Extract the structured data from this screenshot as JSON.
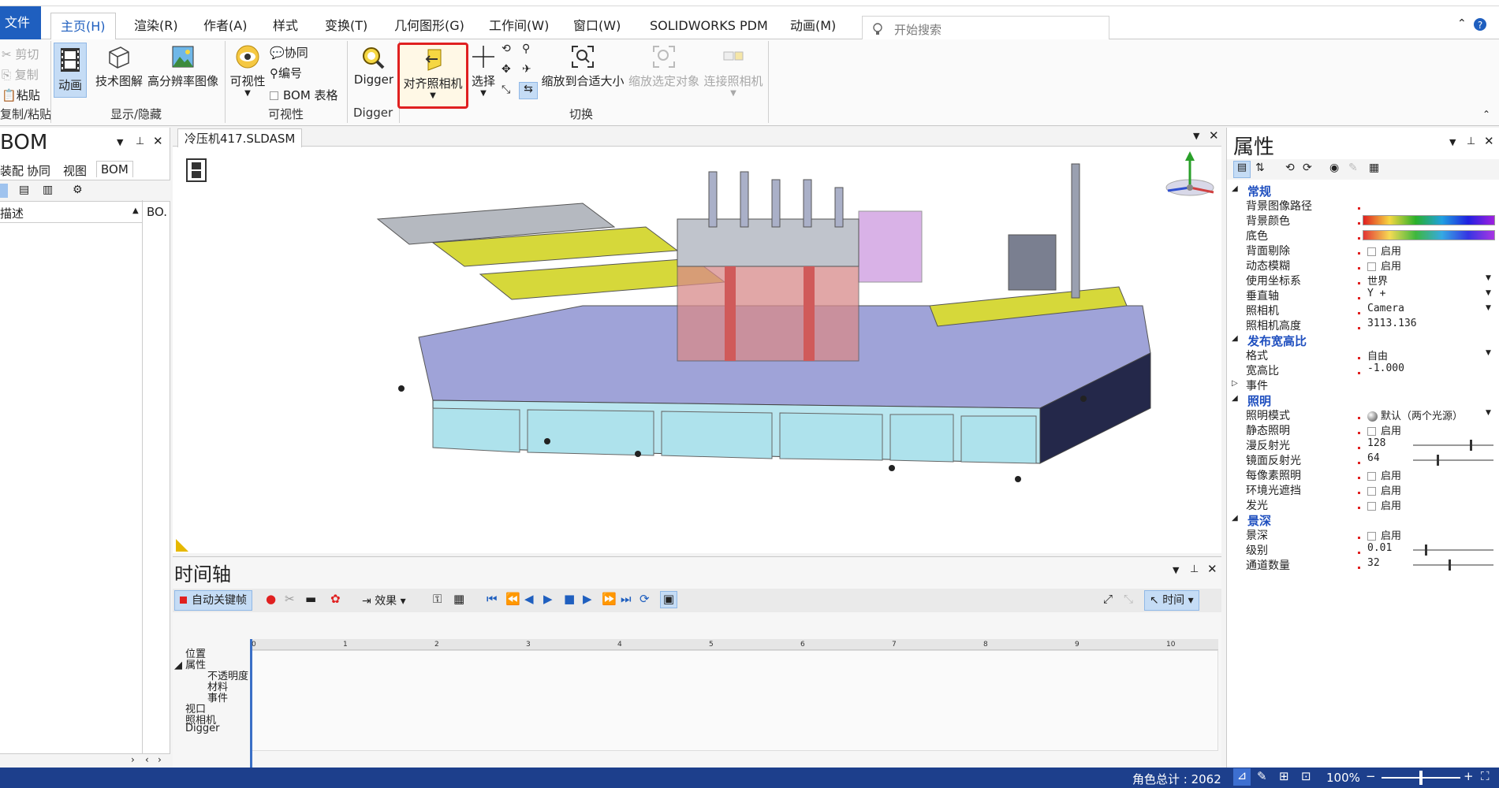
{
  "menu": {
    "file": "文件",
    "tabs": [
      "主页(H)",
      "渲染(R)",
      "作者(A)",
      "样式",
      "变换(T)",
      "几何图形(G)",
      "工作间(W)",
      "窗口(W)",
      "SOLIDWORKS PDM",
      "动画(M)"
    ],
    "search_placeholder": "开始搜索"
  },
  "ribbon": {
    "clipboard": {
      "cut": "剪切",
      "copy": "复制",
      "paste": "粘贴",
      "group": "复制/粘贴"
    },
    "show_hide": {
      "animation": "动画",
      "tech_illustration": "技术图解",
      "hires_image": "高分辨率图像",
      "group": "显示/隐藏"
    },
    "visibility": {
      "visibility": "可视性",
      "collab": "协同",
      "numbering": "编号",
      "bom_table": "BOM 表格",
      "group": "可视性"
    },
    "digger": {
      "label": "Digger",
      "group": "Digger"
    },
    "switch": {
      "align_camera": "对齐照相机",
      "select": "选择",
      "zoom_fit": "缩放到合适大小",
      "zoom_selected": "缩放选定对象",
      "connect_camera": "连接照相机",
      "group": "切换"
    }
  },
  "bom": {
    "title": "BOM",
    "tabs": [
      "装配",
      "协同",
      "视图",
      "BOM"
    ],
    "col_desc": "描述",
    "col_bom": "BO."
  },
  "document": {
    "tab": "冷压机417.SLDASM"
  },
  "properties": {
    "title": "属性",
    "rows": [
      {
        "type": "cat",
        "label": "常规"
      },
      {
        "type": "row",
        "label": "背景图像路径",
        "value": ""
      },
      {
        "type": "row",
        "label": "背景颜色",
        "value": "",
        "kind": "color1"
      },
      {
        "type": "row",
        "label": "底色",
        "value": "",
        "kind": "color2"
      },
      {
        "type": "row",
        "label": "背面剔除",
        "value": "启用",
        "kind": "check"
      },
      {
        "type": "row",
        "label": "动态模糊",
        "value": "启用",
        "kind": "check"
      },
      {
        "type": "row",
        "label": "使用坐标系",
        "value": "世界",
        "kind": "select"
      },
      {
        "type": "row",
        "label": "垂直轴",
        "value": "Y +",
        "kind": "select"
      },
      {
        "type": "row",
        "label": "照相机",
        "value": "Camera",
        "kind": "select"
      },
      {
        "type": "row",
        "label": "照相机高度",
        "value": "3113.136"
      },
      {
        "type": "cat",
        "label": "发布宽高比"
      },
      {
        "type": "row",
        "label": "格式",
        "value": "自由",
        "kind": "select"
      },
      {
        "type": "row",
        "label": "宽高比",
        "value": "-1.000"
      },
      {
        "type": "sub",
        "label": "事件"
      },
      {
        "type": "cat",
        "label": "照明"
      },
      {
        "type": "row",
        "label": "照明模式",
        "value": "默认（两个光源）",
        "kind": "lightsel"
      },
      {
        "type": "row",
        "label": "静态照明",
        "value": "启用",
        "kind": "check"
      },
      {
        "type": "row",
        "label": "漫反射光",
        "value": "128",
        "kind": "slider",
        "level": 0.72
      },
      {
        "type": "row",
        "label": "镜面反射光",
        "value": "64",
        "kind": "slider",
        "level": 0.3
      },
      {
        "type": "row",
        "label": "每像素照明",
        "value": "启用",
        "kind": "check"
      },
      {
        "type": "row",
        "label": "环境光遮挡",
        "value": "启用",
        "kind": "check"
      },
      {
        "type": "row",
        "label": "发光",
        "value": "启用",
        "kind": "check"
      },
      {
        "type": "cat",
        "label": "景深"
      },
      {
        "type": "row",
        "label": "景深",
        "value": "启用",
        "kind": "check"
      },
      {
        "type": "row",
        "label": "级别",
        "value": "0.01",
        "kind": "slider",
        "level": 0.15
      },
      {
        "type": "row",
        "label": "通道数量",
        "value": "32",
        "kind": "slider",
        "level": 0.45
      }
    ]
  },
  "timeline": {
    "title": "时间轴",
    "auto_key": "自动关键帧",
    "effects": "效果",
    "time_mode": "时间",
    "tracks": [
      "位置",
      "属性",
      "不透明度",
      "材料",
      "事件",
      "视口",
      "照相机",
      "Digger"
    ],
    "ruler": [
      "0",
      "1",
      "2",
      "3",
      "4",
      "5",
      "6",
      "7",
      "8",
      "9",
      "10"
    ]
  },
  "status": {
    "actors": "角色总计 : 2062",
    "zoom": "100%"
  },
  "colors": {
    "accent": "#1f5fbf",
    "status_bg": "#1d3f8c",
    "highlight": "#e02020"
  }
}
